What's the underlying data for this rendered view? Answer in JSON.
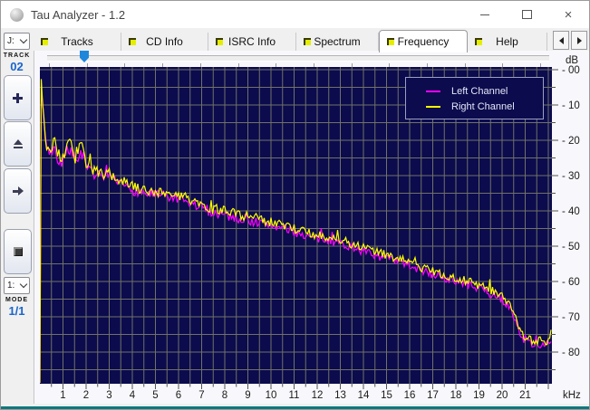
{
  "window": {
    "title": "Tau Analyzer - 1.2"
  },
  "titlebar": {
    "icons": [
      "app-sphere-icon",
      "minimize-icon",
      "maximize-icon",
      "close-icon"
    ]
  },
  "tabs": [
    {
      "label": "Tracks",
      "active": false
    },
    {
      "label": "CD Info",
      "active": false
    },
    {
      "label": "ISRC Info",
      "active": false
    },
    {
      "label": "Spectrum",
      "active": false
    },
    {
      "label": "Frequency",
      "active": true
    },
    {
      "label": "Help",
      "active": false
    }
  ],
  "sidebar": {
    "drive_combo_value": "J:",
    "track_label": "TRACK",
    "track_value": "02",
    "buttons": [
      "plus-icon",
      "eject-icon",
      "arrow-right-icon",
      "stop-icon"
    ],
    "mode_combo_value": "1:",
    "mode_label": "MODE",
    "mode_value": "1/1"
  },
  "colors": {
    "chart_background": "#0b0b4d",
    "grid": "#71716a",
    "left_channel": "#ff00ff",
    "right_channel": "#ffff00",
    "value_blue": "#1a64cc",
    "axis_text": "#1a1a1a",
    "legend_text": "#e6e6fa",
    "slider_thumb": "#1e87dc",
    "bottom_edge": "#0d7a7e"
  },
  "chart_data": {
    "type": "line",
    "title": "",
    "xlabel": "kHz",
    "ylabel": "dB",
    "x_unit_label": "kHz",
    "y_unit_label": "dB",
    "xlim": [
      0,
      22.2
    ],
    "ylim": [
      -89,
      0
    ],
    "x_ticks": [
      1,
      2,
      3,
      4,
      5,
      6,
      7,
      8,
      9,
      10,
      11,
      12,
      13,
      14,
      15,
      16,
      17,
      18,
      19,
      20,
      21
    ],
    "y_tick_labels": [
      "- 00",
      "- 10",
      "- 20",
      "- 30",
      "- 40",
      "- 50",
      "- 60",
      "- 70",
      "- 80"
    ],
    "grid": {
      "on": true,
      "x_step_khz": 0.5,
      "y_step_db": 5
    },
    "legend": {
      "position": "top-right",
      "entries": [
        {
          "label": "Left Channel",
          "color": "#ff00ff"
        },
        {
          "label": "Right Channel",
          "color": "#ffff00"
        }
      ]
    },
    "series": [
      {
        "name": "Left Channel",
        "color": "#ff00ff",
        "points": [
          [
            0.0,
            -89
          ],
          [
            0.05,
            -4
          ],
          [
            0.15,
            -14
          ],
          [
            0.3,
            -22
          ],
          [
            0.5,
            -24
          ],
          [
            0.62,
            -20
          ],
          [
            0.75,
            -25
          ],
          [
            0.9,
            -26
          ],
          [
            1.1,
            -25
          ],
          [
            1.3,
            -22
          ],
          [
            1.5,
            -26
          ],
          [
            1.8,
            -23
          ],
          [
            2.0,
            -28
          ],
          [
            2.5,
            -30
          ],
          [
            3.0,
            -31
          ],
          [
            3.5,
            -32.5
          ],
          [
            4.0,
            -34
          ],
          [
            4.5,
            -35
          ],
          [
            5.0,
            -35.5
          ],
          [
            5.5,
            -36
          ],
          [
            6.0,
            -37
          ],
          [
            6.5,
            -38
          ],
          [
            7.0,
            -39
          ],
          [
            7.5,
            -40.5
          ],
          [
            8.0,
            -41
          ],
          [
            8.5,
            -42
          ],
          [
            9.0,
            -42.5
          ],
          [
            9.5,
            -43.5
          ],
          [
            10.0,
            -44
          ],
          [
            10.5,
            -45
          ],
          [
            11.0,
            -46
          ],
          [
            11.5,
            -47
          ],
          [
            12.0,
            -48
          ],
          [
            12.5,
            -48.5
          ],
          [
            13.0,
            -49
          ],
          [
            13.5,
            -50.5
          ],
          [
            14.0,
            -51.5
          ],
          [
            14.5,
            -52.5
          ],
          [
            15.0,
            -53.5
          ],
          [
            15.5,
            -54.5
          ],
          [
            16.0,
            -55.5
          ],
          [
            16.5,
            -57
          ],
          [
            17.0,
            -58
          ],
          [
            17.5,
            -59
          ],
          [
            18.0,
            -60
          ],
          [
            18.5,
            -61
          ],
          [
            19.0,
            -62
          ],
          [
            19.5,
            -63.5
          ],
          [
            20.0,
            -65
          ],
          [
            20.3,
            -67
          ],
          [
            20.6,
            -72
          ],
          [
            20.9,
            -76
          ],
          [
            21.2,
            -77.5
          ],
          [
            22.2,
            -78
          ]
        ]
      },
      {
        "name": "Right Channel",
        "color": "#ffff00",
        "points": [
          [
            0.0,
            -89
          ],
          [
            0.05,
            -3
          ],
          [
            0.15,
            -13
          ],
          [
            0.3,
            -21
          ],
          [
            0.5,
            -23
          ],
          [
            0.62,
            -18
          ],
          [
            0.75,
            -24
          ],
          [
            0.9,
            -25
          ],
          [
            1.1,
            -24
          ],
          [
            1.3,
            -20
          ],
          [
            1.5,
            -25
          ],
          [
            1.8,
            -21
          ],
          [
            2.0,
            -27
          ],
          [
            2.5,
            -29
          ],
          [
            3.0,
            -30
          ],
          [
            3.5,
            -31.5
          ],
          [
            4.0,
            -33
          ],
          [
            4.5,
            -34
          ],
          [
            5.0,
            -34.5
          ],
          [
            5.5,
            -35
          ],
          [
            6.0,
            -36
          ],
          [
            6.5,
            -37
          ],
          [
            7.0,
            -38
          ],
          [
            7.5,
            -39.5
          ],
          [
            8.0,
            -40
          ],
          [
            8.5,
            -41
          ],
          [
            9.0,
            -41.5
          ],
          [
            9.5,
            -42.5
          ],
          [
            10.0,
            -43
          ],
          [
            10.5,
            -44
          ],
          [
            11.0,
            -45
          ],
          [
            11.5,
            -46
          ],
          [
            12.0,
            -47
          ],
          [
            12.5,
            -47.5
          ],
          [
            13.0,
            -48
          ],
          [
            13.5,
            -49.5
          ],
          [
            14.0,
            -50.5
          ],
          [
            14.5,
            -51.5
          ],
          [
            15.0,
            -52.5
          ],
          [
            15.5,
            -53.5
          ],
          [
            16.0,
            -54.5
          ],
          [
            16.5,
            -56
          ],
          [
            17.0,
            -57
          ],
          [
            17.5,
            -58
          ],
          [
            18.0,
            -59
          ],
          [
            18.5,
            -60
          ],
          [
            19.0,
            -61
          ],
          [
            19.5,
            -62.5
          ],
          [
            20.0,
            -64
          ],
          [
            20.3,
            -66
          ],
          [
            20.6,
            -71
          ],
          [
            20.9,
            -75
          ],
          [
            21.2,
            -76.5
          ],
          [
            22.2,
            -77
          ]
        ]
      }
    ]
  }
}
